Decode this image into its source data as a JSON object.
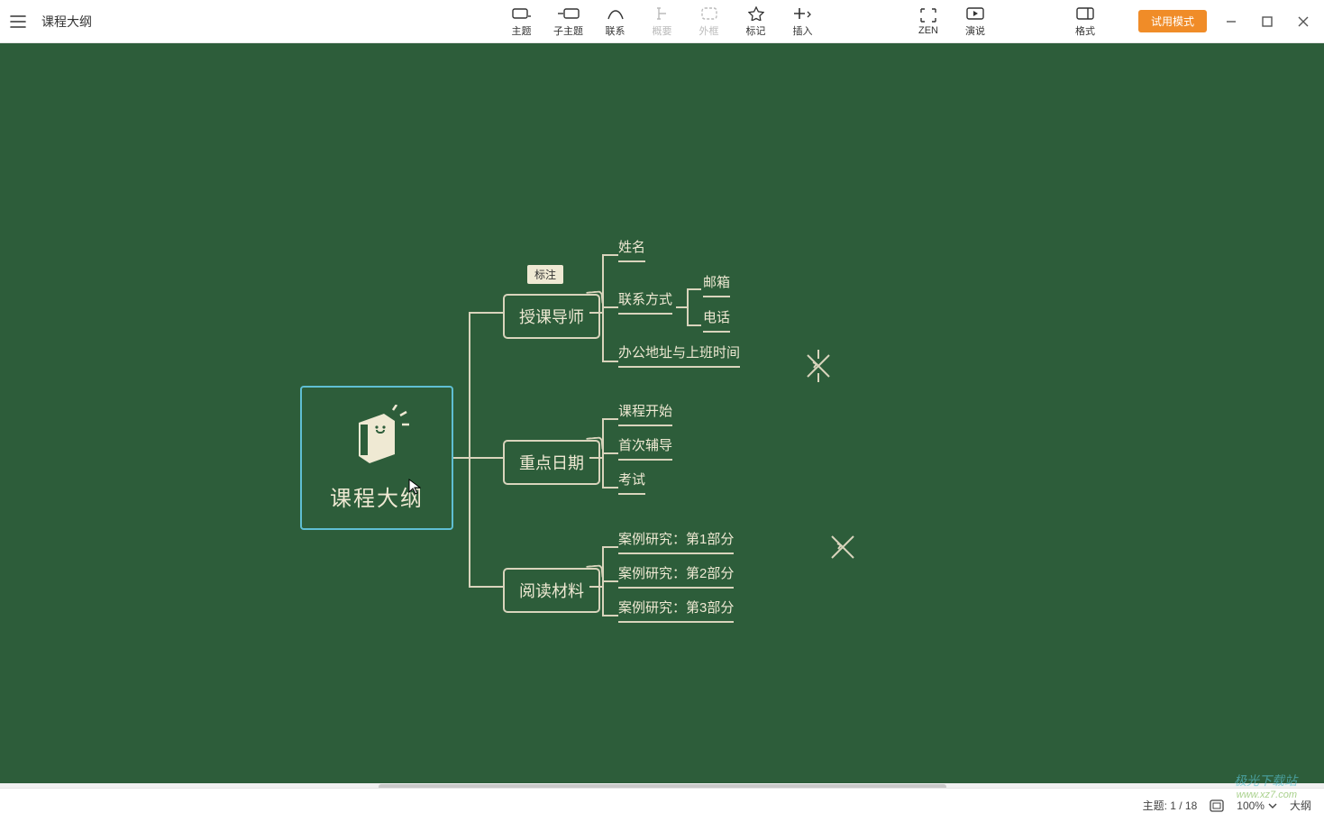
{
  "header": {
    "doc_title": "课程大纲"
  },
  "toolbar": {
    "items": [
      {
        "id": "topic",
        "label": "主题"
      },
      {
        "id": "subtopic",
        "label": "子主题"
      },
      {
        "id": "relation",
        "label": "联系"
      },
      {
        "id": "summary",
        "label": "概要"
      },
      {
        "id": "boundary",
        "label": "外框"
      },
      {
        "id": "marker",
        "label": "标记"
      },
      {
        "id": "insert",
        "label": "插入"
      }
    ],
    "right": [
      {
        "id": "zen",
        "label": "ZEN"
      },
      {
        "id": "present",
        "label": "演说"
      }
    ],
    "format_label": "格式",
    "trial_label": "试用模式"
  },
  "mindmap": {
    "central": "课程大纲",
    "tag": "标注",
    "branches": [
      {
        "label": "授课导师",
        "children": [
          {
            "label": "姓名"
          },
          {
            "label": "联系方式",
            "children": [
              {
                "label": "邮箱"
              },
              {
                "label": "电话"
              }
            ]
          },
          {
            "label": "办公地址与上班时间"
          }
        ]
      },
      {
        "label": "重点日期",
        "children": [
          {
            "label": "课程开始"
          },
          {
            "label": "首次辅导"
          },
          {
            "label": "考试"
          }
        ]
      },
      {
        "label": "阅读材料",
        "children": [
          {
            "label": "案例研究：第1部分"
          },
          {
            "label": "案例研究：第2部分"
          },
          {
            "label": "案例研究：第3部分"
          }
        ]
      }
    ]
  },
  "status": {
    "topic_count": "主题: 1 / 18",
    "zoom": "100%",
    "outline_toggle": "大纲"
  },
  "watermark": {
    "brand": "极光下载站",
    "url": "www.xz7.com"
  }
}
